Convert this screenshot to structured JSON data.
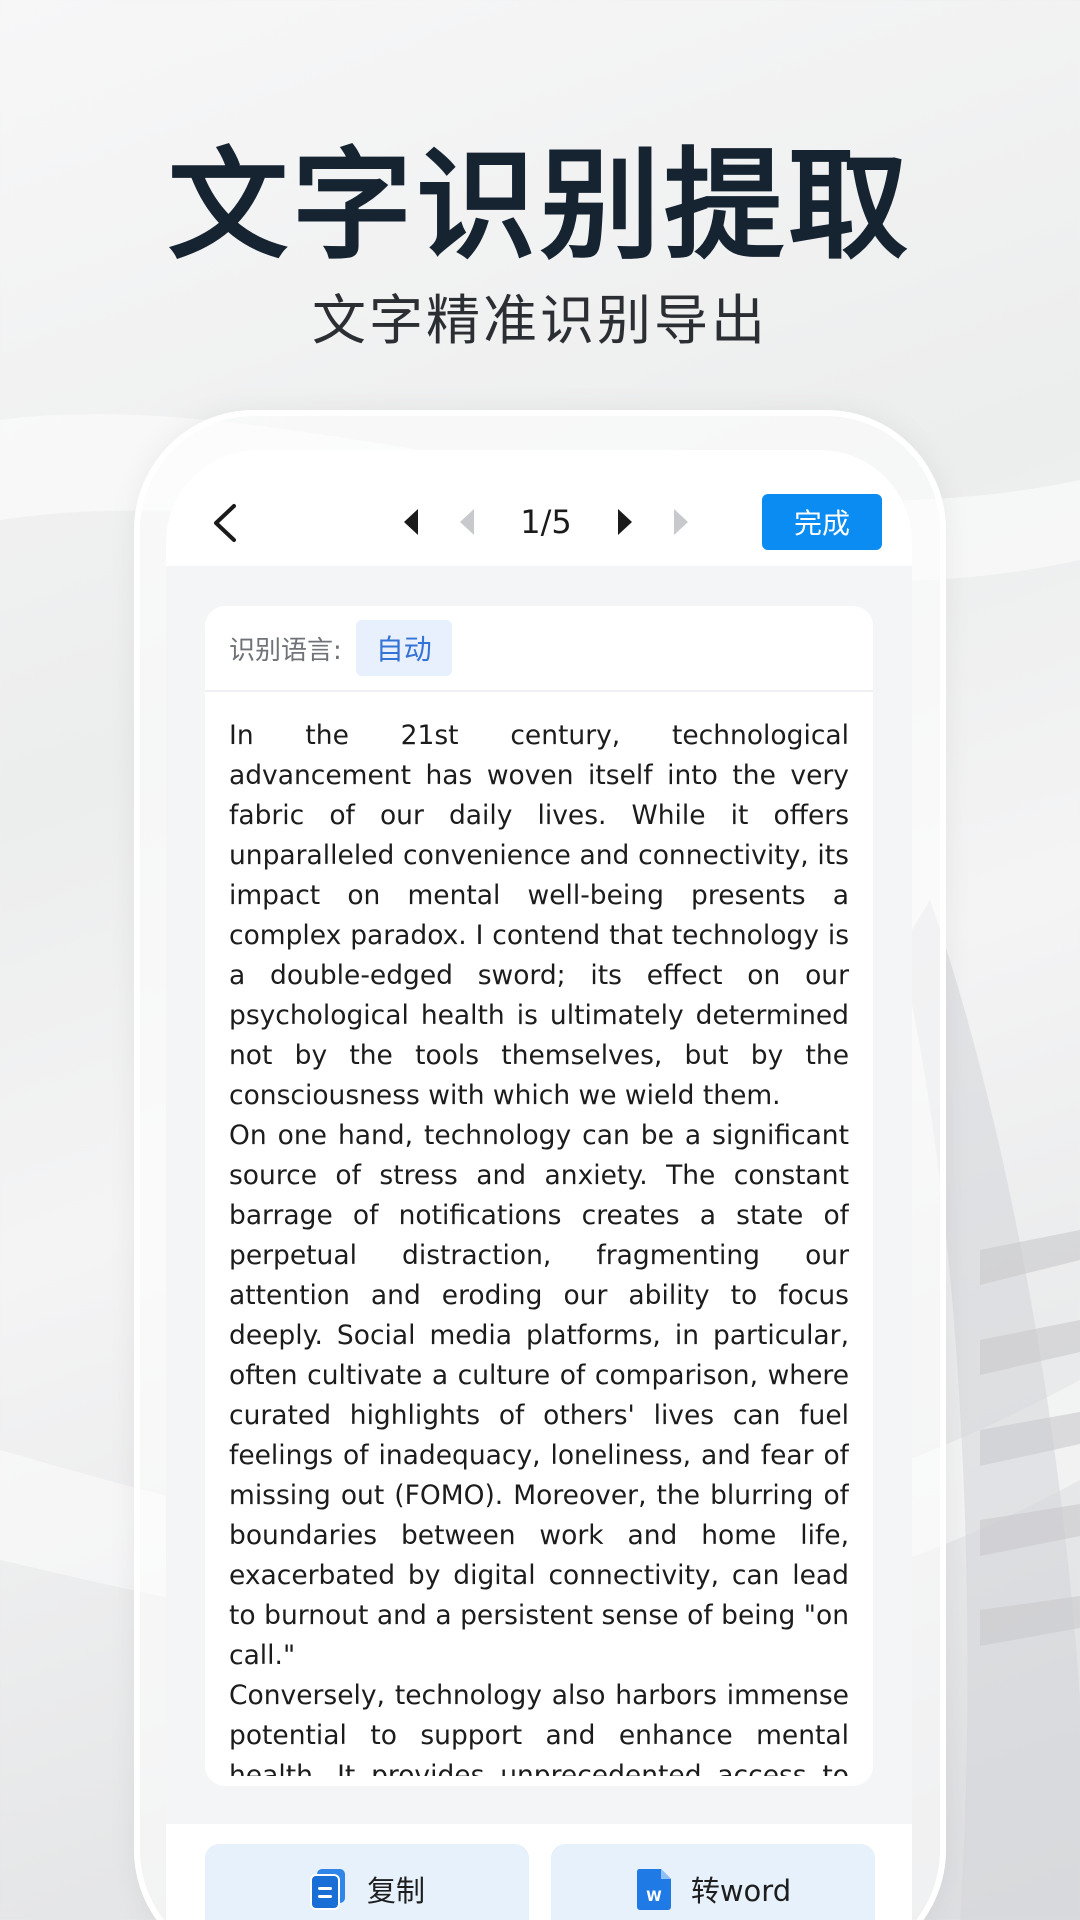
{
  "hero": {
    "title": "文字识别提取",
    "subtitle": "文字精准识别导出"
  },
  "toolbar": {
    "page_indicator": "1/5",
    "done_label": "完成"
  },
  "recognition": {
    "language_label": "识别语言:",
    "language_value": "自动"
  },
  "content": {
    "paragraphs": [
      "In the 21st century, technological advancement has woven itself into the very fabric of our daily lives. While it offers unparalleled convenience and connectivity, its impact on mental well-being presents a complex paradox. I contend that technology is a double-edged sword; its effect on our psychological health is ultimately determined not by the tools themselves, but by the consciousness with which we wield them.",
      "On one hand, technology can be a significant source of stress and anxiety. The constant barrage of notifications creates a state of perpetual distraction, fragmenting our attention and eroding our ability to focus deeply. Social media platforms, in particular, often cultivate a culture of comparison, where curated highlights of others' lives can fuel feelings of inadequacy, loneliness, and fear of missing out (FOMO). Moreover, the blurring of boundaries between work and home life, exacerbated by digital connectivity, can lead to burnout and a persistent sense of being \"on call.\"",
      "Conversely, technology also harbors immense potential to support and enhance mental health. It provides unprecedented access to valuable resources, from online therapy platfor"
    ]
  },
  "actions": {
    "copy_label": "复制",
    "word_label": "转word"
  },
  "colors": {
    "accent": "#0a8cf2",
    "chip_bg": "#e8effd",
    "chip_text": "#3473d6",
    "action_bg": "#e6f1fb"
  }
}
